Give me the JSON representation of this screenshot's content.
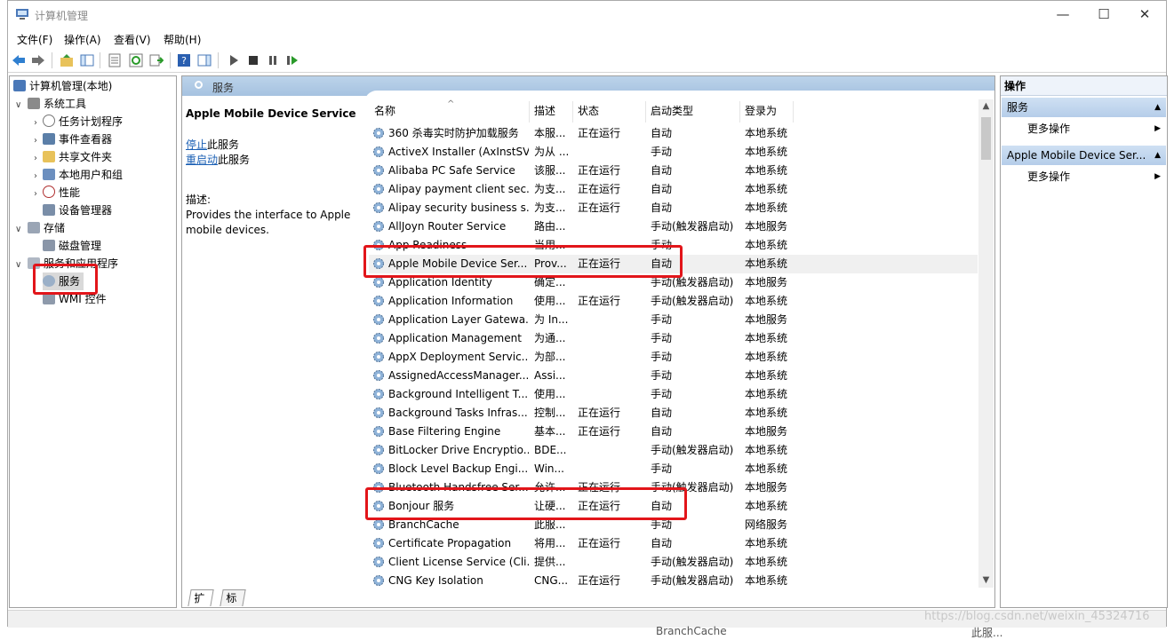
{
  "window": {
    "title": "计算机管理",
    "minimize": "—",
    "maximize": "☐",
    "close": "✕"
  },
  "menu": [
    "文件(F)",
    "操作(A)",
    "查看(V)",
    "帮助(H)"
  ],
  "tree": {
    "root": "计算机管理(本地)",
    "system_tools": "系统工具",
    "task_scheduler": "任务计划程序",
    "event_viewer": "事件查看器",
    "shared_folders": "共享文件夹",
    "local_users": "本地用户和组",
    "performance": "性能",
    "device_manager": "设备管理器",
    "storage": "存储",
    "disk_management": "磁盘管理",
    "services_apps": "服务和应用程序",
    "services": "服务",
    "wmi": "WMI 控件"
  },
  "center": {
    "header": "服务",
    "selected_service": "Apple Mobile Device Service",
    "stop_link": "停止",
    "stop_suffix": "此服务",
    "restart_link": "重启动",
    "restart_suffix": "此服务",
    "desc_label": "描述:",
    "desc_text": "Provides the interface to Apple mobile devices.",
    "columns": {
      "name": "名称",
      "desc": "描述",
      "status": "状态",
      "startup": "启动类型",
      "logon": "登录为"
    },
    "sort_indicator": "^",
    "tabs": [
      "扩展",
      "标准"
    ]
  },
  "services": [
    {
      "name": "360 杀毒实时防护加载服务",
      "desc": "本服...",
      "status": "正在运行",
      "startup": "自动",
      "logon": "本地系统"
    },
    {
      "name": "ActiveX Installer (AxInstSV)",
      "desc": "为从 ...",
      "status": "",
      "startup": "手动",
      "logon": "本地系统"
    },
    {
      "name": "Alibaba PC Safe Service",
      "desc": "该服...",
      "status": "正在运行",
      "startup": "自动",
      "logon": "本地系统"
    },
    {
      "name": "Alipay payment client sec...",
      "desc": "为支...",
      "status": "正在运行",
      "startup": "自动",
      "logon": "本地系统"
    },
    {
      "name": "Alipay security business s...",
      "desc": "为支...",
      "status": "正在运行",
      "startup": "自动",
      "logon": "本地系统"
    },
    {
      "name": "AllJoyn Router Service",
      "desc": "路由...",
      "status": "",
      "startup": "手动(触发器启动)",
      "logon": "本地服务"
    },
    {
      "name": "App Readiness",
      "desc": "当用...",
      "status": "",
      "startup": "手动",
      "logon": "本地系统"
    },
    {
      "name": "Apple Mobile Device Ser...",
      "desc": "Prov...",
      "status": "正在运行",
      "startup": "自动",
      "logon": "本地系统"
    },
    {
      "name": "Application Identity",
      "desc": "确定...",
      "status": "",
      "startup": "手动(触发器启动)",
      "logon": "本地服务"
    },
    {
      "name": "Application Information",
      "desc": "使用...",
      "status": "正在运行",
      "startup": "手动(触发器启动)",
      "logon": "本地系统"
    },
    {
      "name": "Application Layer Gatewa...",
      "desc": "为 In...",
      "status": "",
      "startup": "手动",
      "logon": "本地服务"
    },
    {
      "name": "Application Management",
      "desc": "为通...",
      "status": "",
      "startup": "手动",
      "logon": "本地系统"
    },
    {
      "name": "AppX Deployment Servic...",
      "desc": "为部...",
      "status": "",
      "startup": "手动",
      "logon": "本地系统"
    },
    {
      "name": "AssignedAccessManager...",
      "desc": "Assi...",
      "status": "",
      "startup": "手动",
      "logon": "本地系统"
    },
    {
      "name": "Background Intelligent T...",
      "desc": "使用...",
      "status": "",
      "startup": "手动",
      "logon": "本地系统"
    },
    {
      "name": "Background Tasks Infras...",
      "desc": "控制...",
      "status": "正在运行",
      "startup": "自动",
      "logon": "本地系统"
    },
    {
      "name": "Base Filtering Engine",
      "desc": "基本...",
      "status": "正在运行",
      "startup": "自动",
      "logon": "本地服务"
    },
    {
      "name": "BitLocker Drive Encryptio...",
      "desc": "BDE...",
      "status": "",
      "startup": "手动(触发器启动)",
      "logon": "本地系统"
    },
    {
      "name": "Block Level Backup Engi...",
      "desc": "Win...",
      "status": "",
      "startup": "手动",
      "logon": "本地系统"
    },
    {
      "name": "Bluetooth Handsfree Ser...",
      "desc": "允许...",
      "status": "正在运行",
      "startup": "手动(触发器启动)",
      "logon": "本地服务"
    },
    {
      "name": "Bonjour 服务",
      "desc": "让硬...",
      "status": "正在运行",
      "startup": "自动",
      "logon": "本地系统"
    },
    {
      "name": "BranchCache",
      "desc": "此服...",
      "status": "",
      "startup": "手动",
      "logon": "网络服务"
    },
    {
      "name": "Certificate Propagation",
      "desc": "将用...",
      "status": "正在运行",
      "startup": "自动",
      "logon": "本地系统"
    },
    {
      "name": "Client License Service (Cli...",
      "desc": "提供...",
      "status": "",
      "startup": "手动(触发器启动)",
      "logon": "本地系统"
    },
    {
      "name": "CNG Key Isolation",
      "desc": "CNG...",
      "status": "正在运行",
      "startup": "手动(触发器启动)",
      "logon": "本地系统"
    }
  ],
  "actions": {
    "title": "操作",
    "section1": "服务",
    "more1": "更多操作",
    "section2": "Apple Mobile Device Ser...",
    "more2": "更多操作"
  },
  "under": {
    "text1": "BranchCache",
    "text2": "此服..."
  },
  "watermark": "https://blog.csdn.net/weixin_45324716",
  "colors": {
    "highlight_box": "#e2151a",
    "header_blue": "#a6c2e0",
    "link": "#1a5fb4"
  }
}
